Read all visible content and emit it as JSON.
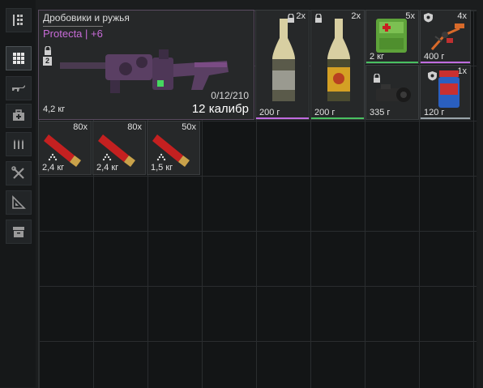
{
  "sidebar": {
    "items": [
      {
        "name": "sort-icon"
      },
      {
        "name": "grid-icon",
        "active": true
      },
      {
        "name": "rifle-icon"
      },
      {
        "name": "medkit-icon"
      },
      {
        "name": "ammo-icon"
      },
      {
        "name": "tools-icon"
      },
      {
        "name": "ruler-icon"
      },
      {
        "name": "crate-icon"
      }
    ]
  },
  "weapon": {
    "title": "Дробовики и ружья",
    "subtitle": "Protecta | +6",
    "level": "2",
    "weight": "4,2 кг",
    "ammo": "0/12/210",
    "caliber": "12 калибр"
  },
  "items": {
    "bottle1": {
      "count": "2x",
      "weight": "200 г"
    },
    "bottle2": {
      "count": "2x",
      "weight": "200 г"
    },
    "medkit": {
      "count": "5x",
      "weight": "2 кг"
    },
    "drone": {
      "count": "4x",
      "weight": "400 г"
    },
    "camera": {
      "weight": "335 г"
    },
    "jar": {
      "count": "1x",
      "weight": "120 г"
    },
    "shell1": {
      "count": "80x",
      "weight": "2,4 кг"
    },
    "shell2": {
      "count": "80x",
      "weight": "2,4 кг"
    },
    "shell3": {
      "count": "50x",
      "weight": "1,5 кг"
    }
  },
  "colors": {
    "weapon_accent": "#b24fd1",
    "bottle1_line": "#c06be0",
    "bottle2_line": "#48c060",
    "medkit_line": "#48c060",
    "drone_line": "#c06be0",
    "jar_line": "#9aa4aa"
  }
}
